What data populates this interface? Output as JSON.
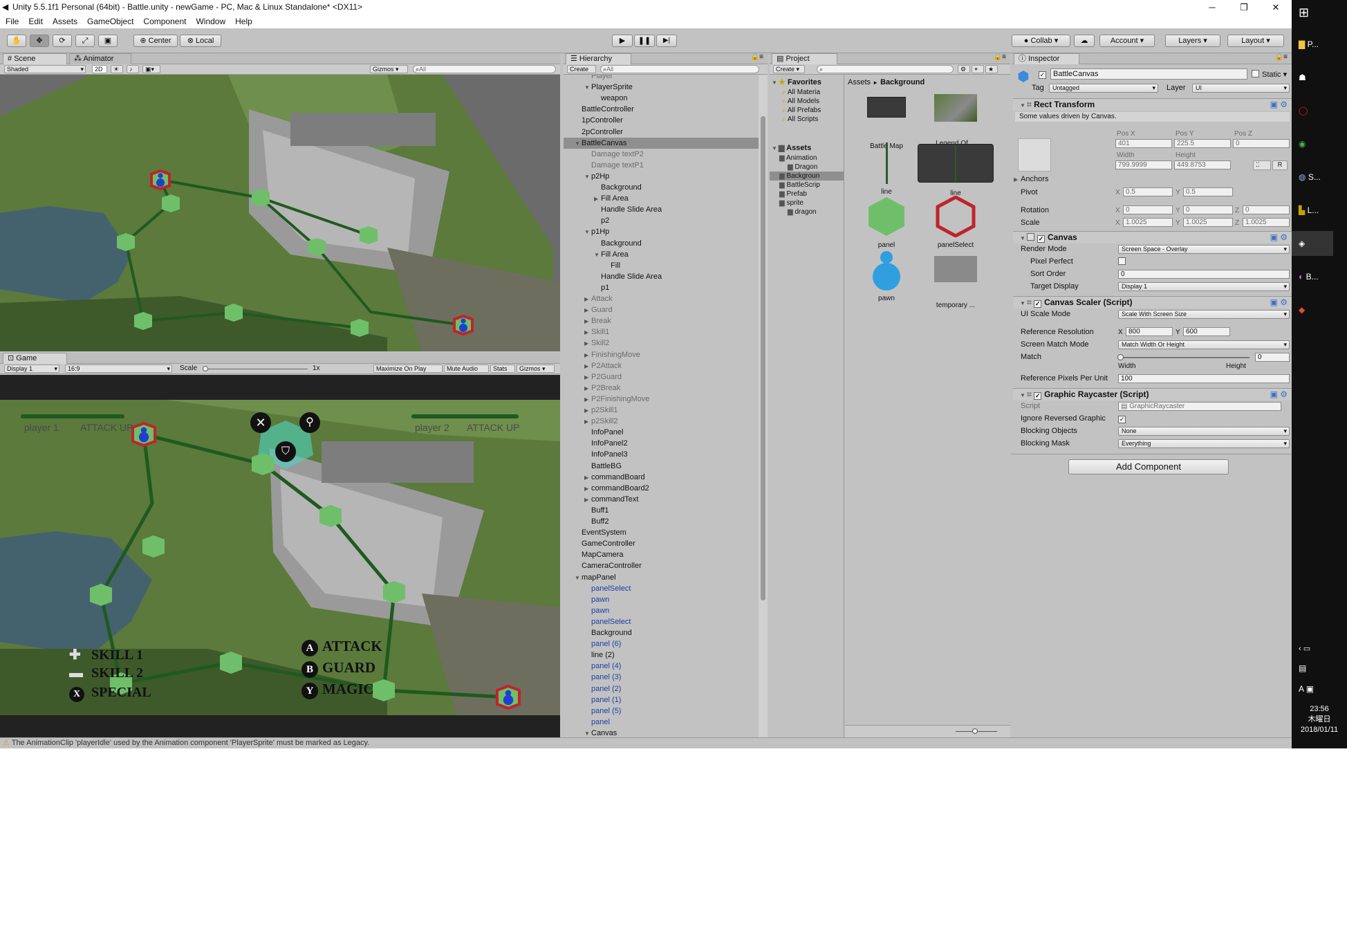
{
  "window": {
    "title": "Unity 5.5.1f1 Personal (64bit) - Battle.unity - newGame - PC, Mac & Linux Standalone* <DX11>",
    "controls": [
      "─",
      "❐",
      "✕"
    ]
  },
  "menu": [
    "File",
    "Edit",
    "Assets",
    "GameObject",
    "Component",
    "Window",
    "Help"
  ],
  "toolbar": {
    "pivot": "Center",
    "space": "Local",
    "collab": "Collab",
    "account": "Account",
    "layers": "Layers",
    "layout": "Layout",
    "play": "▶",
    "pause": "❚❚",
    "step": "▶|"
  },
  "scene": {
    "tab_scene": "Scene",
    "tab_animator": "Animator",
    "shading": "Shaded",
    "mode2d": "2D",
    "gizmos": "Gizmos",
    "search_placeholder": "All"
  },
  "game": {
    "tab": "Game",
    "display": "Display 1",
    "aspect": "16:9",
    "scale_label": "Scale",
    "scale_value": "1x",
    "buttons": [
      "Maximize On Play",
      "Mute Audio",
      "Stats",
      "Gizmos"
    ],
    "hud": {
      "player1": "player 1",
      "player1_buff": "ATTACK UP",
      "player2": "player 2",
      "player2_buff": "ATTACK UP",
      "skills": [
        {
          "key": "✚",
          "label": "SKILL 1"
        },
        {
          "key": "▬",
          "label": "SKILL 2"
        },
        {
          "key": "X",
          "label": "SPECIAL"
        }
      ],
      "commands": [
        {
          "key": "A",
          "label": "ATTACK"
        },
        {
          "key": "B",
          "label": "GUARD"
        },
        {
          "key": "Y",
          "label": "MAGIC"
        }
      ]
    }
  },
  "hierarchy": {
    "tab": "Hierarchy",
    "create": "Create",
    "search_placeholder": "All",
    "items": [
      {
        "text": "Player",
        "depth": 2,
        "arrow": "",
        "color": "gray"
      },
      {
        "text": "PlayerSprite",
        "depth": 2,
        "arrow": "▼",
        "color": "normal"
      },
      {
        "text": "weapon",
        "depth": 3,
        "arrow": "",
        "color": "normal"
      },
      {
        "text": "BattleController",
        "depth": 1,
        "arrow": "",
        "color": "normal"
      },
      {
        "text": "1pController",
        "depth": 1,
        "arrow": "",
        "color": "normal"
      },
      {
        "text": "2pController",
        "depth": 1,
        "arrow": "",
        "color": "normal"
      },
      {
        "text": "BattleCanvas",
        "depth": 1,
        "arrow": "▼",
        "color": "normal",
        "selected": true
      },
      {
        "text": "Damage textP2",
        "depth": 2,
        "arrow": "",
        "color": "gray"
      },
      {
        "text": "Damage textP1",
        "depth": 2,
        "arrow": "",
        "color": "gray"
      },
      {
        "text": "p2Hp",
        "depth": 2,
        "arrow": "▼",
        "color": "normal"
      },
      {
        "text": "Background",
        "depth": 3,
        "arrow": "",
        "color": "normal"
      },
      {
        "text": "Fill Area",
        "depth": 3,
        "arrow": "▶",
        "color": "normal"
      },
      {
        "text": "Handle Slide Area",
        "depth": 3,
        "arrow": "",
        "color": "normal"
      },
      {
        "text": "p2",
        "depth": 3,
        "arrow": "",
        "color": "normal"
      },
      {
        "text": "p1Hp",
        "depth": 2,
        "arrow": "▼",
        "color": "normal"
      },
      {
        "text": "Background",
        "depth": 3,
        "arrow": "",
        "color": "normal"
      },
      {
        "text": "Fill Area",
        "depth": 3,
        "arrow": "▼",
        "color": "normal"
      },
      {
        "text": "Fill",
        "depth": 4,
        "arrow": "",
        "color": "normal"
      },
      {
        "text": "Handle Slide Area",
        "depth": 3,
        "arrow": "",
        "color": "normal"
      },
      {
        "text": "p1",
        "depth": 3,
        "arrow": "",
        "color": "normal"
      },
      {
        "text": "Attack",
        "depth": 2,
        "arrow": "▶",
        "color": "gray"
      },
      {
        "text": "Guard",
        "depth": 2,
        "arrow": "▶",
        "color": "gray"
      },
      {
        "text": "Break",
        "depth": 2,
        "arrow": "▶",
        "color": "gray"
      },
      {
        "text": "Skill1",
        "depth": 2,
        "arrow": "▶",
        "color": "gray"
      },
      {
        "text": "Skill2",
        "depth": 2,
        "arrow": "▶",
        "color": "gray"
      },
      {
        "text": "FinishingMove",
        "depth": 2,
        "arrow": "▶",
        "color": "gray"
      },
      {
        "text": "P2Attack",
        "depth": 2,
        "arrow": "▶",
        "color": "gray"
      },
      {
        "text": "P2Guard",
        "depth": 2,
        "arrow": "▶",
        "color": "gray"
      },
      {
        "text": "P2Break",
        "depth": 2,
        "arrow": "▶",
        "color": "gray"
      },
      {
        "text": "P2FinishingMove",
        "depth": 2,
        "arrow": "▶",
        "color": "gray"
      },
      {
        "text": "p2Skill1",
        "depth": 2,
        "arrow": "▶",
        "color": "gray"
      },
      {
        "text": "p2Skill2",
        "depth": 2,
        "arrow": "▶",
        "color": "gray"
      },
      {
        "text": "InfoPanel",
        "depth": 2,
        "arrow": "",
        "color": "normal"
      },
      {
        "text": "InfoPanel2",
        "depth": 2,
        "arrow": "",
        "color": "normal"
      },
      {
        "text": "InfoPanel3",
        "depth": 2,
        "arrow": "",
        "color": "normal"
      },
      {
        "text": "BattleBG",
        "depth": 2,
        "arrow": "",
        "color": "normal"
      },
      {
        "text": "commandBoard",
        "depth": 2,
        "arrow": "▶",
        "color": "normal"
      },
      {
        "text": "commandBoard2",
        "depth": 2,
        "arrow": "▶",
        "color": "normal"
      },
      {
        "text": "commandText",
        "depth": 2,
        "arrow": "▶",
        "color": "normal"
      },
      {
        "text": "Buff1",
        "depth": 2,
        "arrow": "",
        "color": "normal"
      },
      {
        "text": "Buff2",
        "depth": 2,
        "arrow": "",
        "color": "normal"
      },
      {
        "text": "EventSystem",
        "depth": 1,
        "arrow": "",
        "color": "normal"
      },
      {
        "text": "GameController",
        "depth": 1,
        "arrow": "",
        "color": "normal"
      },
      {
        "text": "MapCamera",
        "depth": 1,
        "arrow": "",
        "color": "normal"
      },
      {
        "text": "CameraController",
        "depth": 1,
        "arrow": "",
        "color": "normal"
      },
      {
        "text": "mapPanel",
        "depth": 1,
        "arrow": "▼",
        "color": "normal"
      },
      {
        "text": "panelSelect",
        "depth": 2,
        "arrow": "",
        "color": "blue"
      },
      {
        "text": "pawn",
        "depth": 2,
        "arrow": "",
        "color": "blue"
      },
      {
        "text": "pawn",
        "depth": 2,
        "arrow": "",
        "color": "blue"
      },
      {
        "text": "panelSelect",
        "depth": 2,
        "arrow": "",
        "color": "blue"
      },
      {
        "text": "Background",
        "depth": 2,
        "arrow": "",
        "color": "normal"
      },
      {
        "text": "panel (6)",
        "depth": 2,
        "arrow": "",
        "color": "blue"
      },
      {
        "text": "line (2)",
        "depth": 2,
        "arrow": "",
        "color": "normal"
      },
      {
        "text": "panel (4)",
        "depth": 2,
        "arrow": "",
        "color": "blue"
      },
      {
        "text": "panel (3)",
        "depth": 2,
        "arrow": "",
        "color": "blue"
      },
      {
        "text": "panel (2)",
        "depth": 2,
        "arrow": "",
        "color": "blue"
      },
      {
        "text": "panel (1)",
        "depth": 2,
        "arrow": "",
        "color": "blue"
      },
      {
        "text": "panel (5)",
        "depth": 2,
        "arrow": "",
        "color": "blue"
      },
      {
        "text": "panel",
        "depth": 2,
        "arrow": "",
        "color": "blue"
      },
      {
        "text": "Canvas",
        "depth": 2,
        "arrow": "▼",
        "color": "normal"
      }
    ]
  },
  "project": {
    "tab": "Project",
    "create": "Create",
    "favorites_label": "Favorites",
    "favorites": [
      "All Materia",
      "All Models",
      "All Prefabs",
      "All Scripts"
    ],
    "assets_label": "Assets",
    "tree": [
      {
        "text": "Animation",
        "depth": 1
      },
      {
        "text": "Dragon",
        "depth": 2
      },
      {
        "text": "Backgroun",
        "depth": 1,
        "selected": true
      },
      {
        "text": "BattleScrip",
        "depth": 1
      },
      {
        "text": "Prefab",
        "depth": 1
      },
      {
        "text": "sprite",
        "depth": 1
      },
      {
        "text": "dragon",
        "depth": 2
      }
    ],
    "breadcrumb_root": "Assets",
    "breadcrumb_sep": "►",
    "breadcrumb_current": "Background",
    "assets": [
      {
        "name": "Battle Map",
        "kind": "darkrect"
      },
      {
        "name": "Legend Of ...",
        "kind": "mapthumb"
      },
      {
        "name": "line",
        "kind": "vline"
      },
      {
        "name": "line",
        "kind": "darkbox"
      },
      {
        "name": "panel",
        "kind": "hexgreen"
      },
      {
        "name": "panelSelect",
        "kind": "hexred"
      },
      {
        "name": "pawn",
        "kind": "pawn"
      },
      {
        "name": "temporary ...",
        "kind": "grayrect"
      }
    ]
  },
  "inspector": {
    "tab": "Inspector",
    "object_name": "BattleCanvas",
    "static_label": "Static",
    "tag_label": "Tag",
    "tag": "Untagged",
    "layer_label": "Layer",
    "layer": "UI",
    "rect": {
      "title": "Rect Transform",
      "note": "Some values driven by Canvas.",
      "posx_label": "Pos X",
      "posy_label": "Pos Y",
      "posz_label": "Pos Z",
      "posx": "401",
      "posy": "225.5",
      "posz": "0",
      "width_label": "Width",
      "height_label": "Height",
      "width": "799.9999",
      "height": "449.8753",
      "anchors": "Anchors",
      "pivot": "Pivot",
      "pivot_x": "0.5",
      "pivot_y": "0.5",
      "rotation": "Rotation",
      "rot_x": "0",
      "rot_y": "0",
      "rot_z": "0",
      "scale": "Scale",
      "scale_x": "1.0025",
      "scale_y": "1.0025",
      "scale_z": "1.0025",
      "x": "X",
      "y": "Y",
      "z": "Z",
      "r_btn": "R"
    },
    "canvas": {
      "title": "Canvas",
      "render_mode_label": "Render Mode",
      "render_mode": "Screen Space - Overlay",
      "pixel_perfect": "Pixel Perfect",
      "sort_order_label": "Sort Order",
      "sort_order": "0",
      "target_display_label": "Target Display",
      "target_display": "Display 1"
    },
    "scaler": {
      "title": "Canvas Scaler (Script)",
      "ui_scale_mode_label": "UI Scale Mode",
      "ui_scale_mode": "Scale With Screen Size",
      "ref_res_label": "Reference Resolution",
      "ref_x": "800",
      "ref_y": "600",
      "match_mode_label": "Screen Match Mode",
      "match_mode": "Match Width Or Height",
      "match_label": "Match",
      "match_value": "0",
      "match_level": 0,
      "width_word": "Width",
      "height_word": "Height",
      "ppu_label": "Reference Pixels Per Unit",
      "ppu": "100"
    },
    "raycaster": {
      "title": "Graphic Raycaster (Script)",
      "script_label": "Script",
      "script": "GraphicRaycaster",
      "ignore_label": "Ignore Reversed Graphic",
      "blocking_objects_label": "Blocking Objects",
      "blocking_objects": "None",
      "blocking_mask_label": "Blocking Mask",
      "blocking_mask": "Everything"
    },
    "add_component": "Add Component"
  },
  "console": {
    "warning": "The AnimationClip 'playerIdle' used by the Animation component 'PlayerSprite' must be marked as Legacy."
  },
  "taskbar": {
    "items": [
      "P...",
      "S...",
      "L...",
      "B..."
    ],
    "time": "23:56",
    "day": "木曜日",
    "date": "2018/01/11",
    "ime": "A"
  },
  "colors": {
    "hex": "#6fbf6a",
    "line": "#1f5a1f",
    "selected": "#3d6ec9",
    "editor_bg": "#c2c2c2"
  }
}
